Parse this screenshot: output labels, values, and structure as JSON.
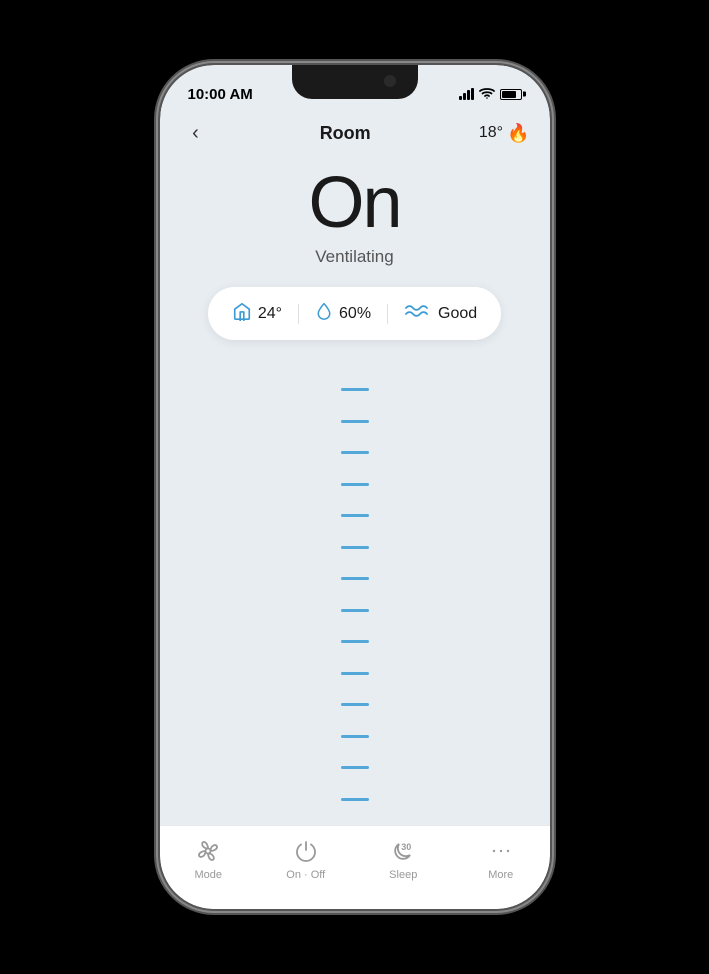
{
  "status_bar": {
    "time": "10:00 AM"
  },
  "header": {
    "back_label": "‹",
    "title": "Room",
    "temperature": "18°",
    "weather_icon": "🔥"
  },
  "main": {
    "power_status": "On",
    "status_text": "Ventilating",
    "info": {
      "temp_icon": "home",
      "temp_value": "24°",
      "humidity_icon": "drop",
      "humidity_value": "60%",
      "air_icon": "waves",
      "air_value": "Good"
    }
  },
  "nav": {
    "mode_label": "Mode",
    "on_off_label": "On · Off",
    "sleep_label": "Sleep",
    "more_label": "More",
    "sleep_number": "30"
  }
}
